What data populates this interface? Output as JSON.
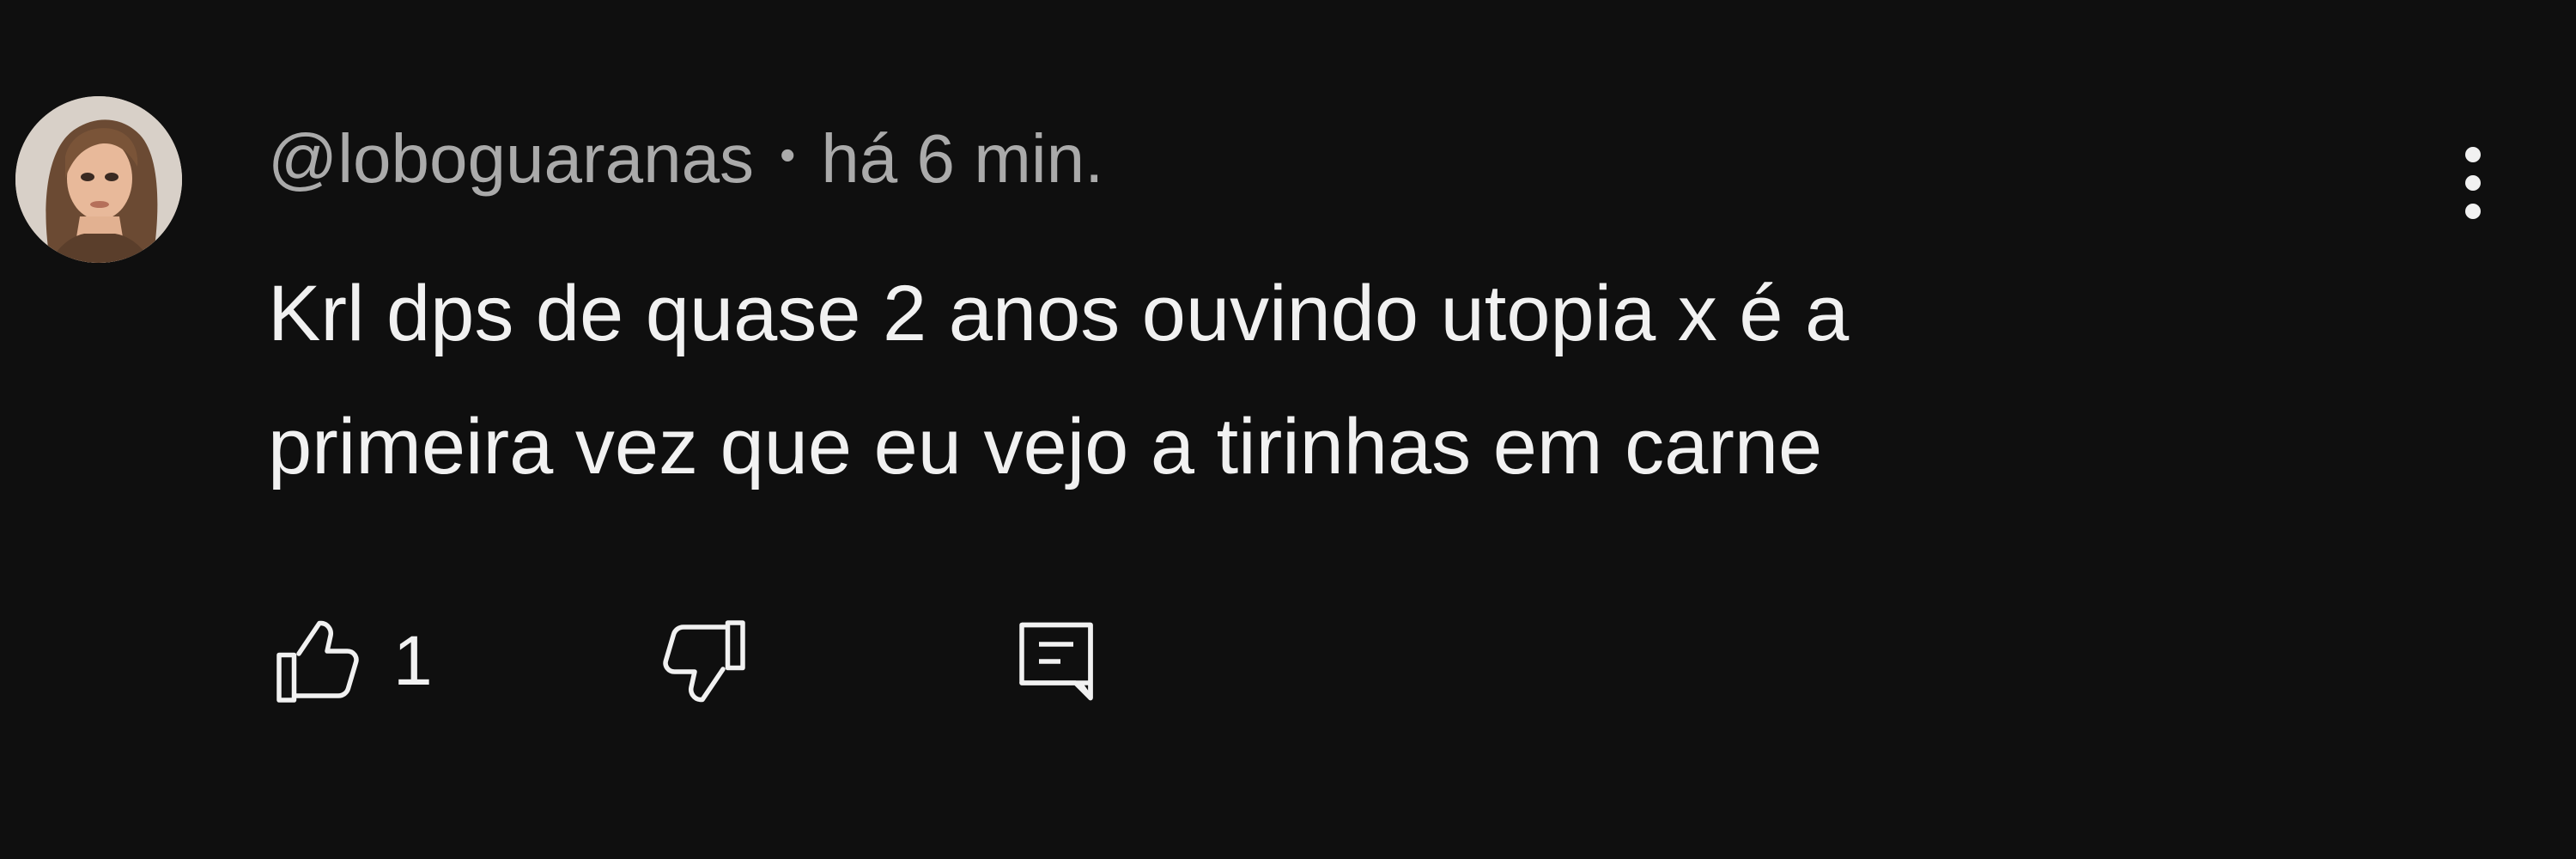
{
  "comment": {
    "author": "@loboguaranas",
    "separator": "•",
    "time": "há 6 min.",
    "text_lines": [
      "Krl dps de quase 2 anos ouvindo utopia x é a",
      "primeira vez que eu vejo a tirinhas em carne"
    ],
    "like_count": "1"
  },
  "icons": {
    "avatar": "user-avatar-photo",
    "menu": "more-vertical-icon",
    "like": "thumbs-up-icon",
    "dislike": "thumbs-down-icon",
    "reply": "reply-comment-icon"
  },
  "colors": {
    "background": "#0f0f0f",
    "primary_text": "#f1f1f1",
    "secondary_text": "#aaaaaa"
  }
}
